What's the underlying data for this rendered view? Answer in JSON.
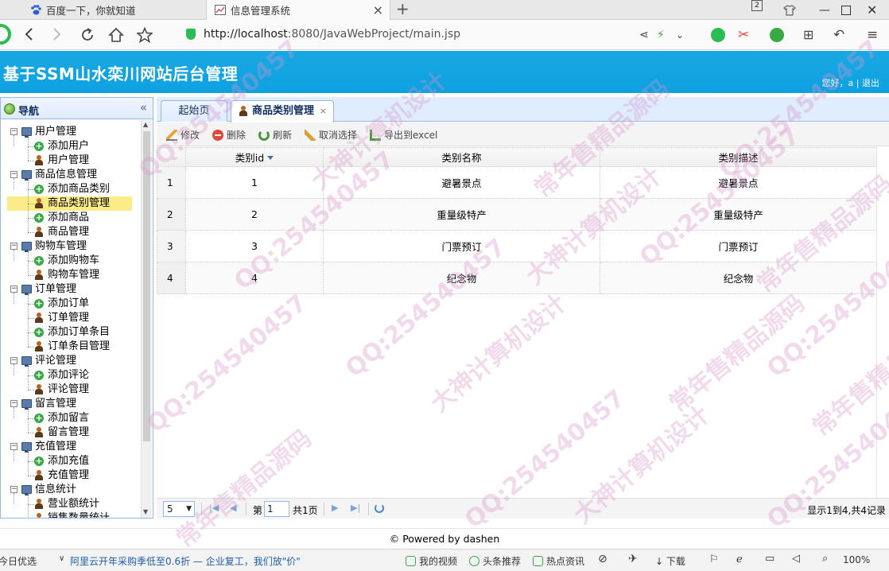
{
  "browser": {
    "tabs": [
      {
        "title": "百度一下，你就知道",
        "icon": "baidu-paw-icon"
      },
      {
        "title": "信息管理系统",
        "icon": "chart-page-icon"
      }
    ],
    "tab_count_badge": "2",
    "url_host": "http://localhost",
    "url_rest": ":8080/JavaWebProject/main.jsp",
    "zoom": "100%"
  },
  "app": {
    "title": "基于SSM山水栾川网站后台管理",
    "greeting": "您好，a",
    "separator": "|",
    "logout": "退出",
    "accent": "#0ea0e0"
  },
  "nav": {
    "title": "导航",
    "collapse_glyph": "«",
    "groups": [
      {
        "label": "用户管理",
        "items": [
          "添加用户",
          "用户管理"
        ]
      },
      {
        "label": "商品信息管理",
        "items": [
          "添加商品类别",
          "商品类别管理",
          "添加商品",
          "商品管理"
        ]
      },
      {
        "label": "购物车管理",
        "items": [
          "添加购物车",
          "购物车管理"
        ]
      },
      {
        "label": "订单管理",
        "items": [
          "添加订单",
          "订单管理",
          "添加订单条目",
          "订单条目管理"
        ]
      },
      {
        "label": "评论管理",
        "items": [
          "添加评论",
          "评论管理"
        ]
      },
      {
        "label": "留言管理",
        "items": [
          "添加留言",
          "留言管理"
        ]
      },
      {
        "label": "充值管理",
        "items": [
          "添加充值",
          "充值管理"
        ]
      },
      {
        "label": "信息统计",
        "items": [
          "营业额统计",
          "销售数量统计"
        ]
      }
    ],
    "selected": "商品类别管理"
  },
  "tabs": {
    "home": "起始页",
    "active": "商品类别管理",
    "close_glyph": "×"
  },
  "toolbar": {
    "edit": "修改",
    "delete": "删除",
    "refresh": "刷新",
    "cancel_select": "取消选择",
    "export": "导出到excel"
  },
  "grid": {
    "columns": [
      "类别id",
      "类别名称",
      "类别描述"
    ],
    "rows": [
      {
        "n": "1",
        "id": "1",
        "name": "避暑景点",
        "desc": "避暑景点"
      },
      {
        "n": "2",
        "id": "2",
        "name": "重量级特产",
        "desc": "重量级特产"
      },
      {
        "n": "3",
        "id": "3",
        "name": "门票预订",
        "desc": "门票预订"
      },
      {
        "n": "4",
        "id": "4",
        "name": "纪念物",
        "desc": "纪念物"
      }
    ]
  },
  "pager": {
    "page_size": "5",
    "page_prefix": "第",
    "page_value": "1",
    "page_total": "共1页",
    "info": "显示1到4,共4记录"
  },
  "footer": "© Powered by dashen",
  "statusbar": {
    "left": "今日优选",
    "news": "阿里云开年采购季低至0.6折 — 企业复工，我们放\"价\"",
    "video": "我的视频",
    "headlines": "头条推荐",
    "hot": "热点资讯",
    "download": "下载"
  },
  "watermark": {
    "qq": "QQ:254540457",
    "a": "大神计算机设计",
    "b": "常年售精品源码"
  }
}
